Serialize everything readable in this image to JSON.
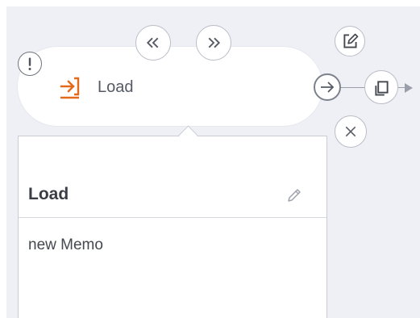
{
  "node": {
    "label": "Load",
    "status": "warning",
    "icon": "import-arrow-icon",
    "accent_color": "#e36a1a"
  },
  "toolbar": {
    "prev_icon": "double-chevron-left-icon",
    "next_icon": "double-chevron-right-icon",
    "edit_icon": "edit-icon",
    "connect_icon": "arrow-right-icon",
    "duplicate_icon": "copy-icon",
    "delete_icon": "close-icon"
  },
  "panel": {
    "title": "Load",
    "memo": "new Memo",
    "edit_icon": "pencil-icon"
  }
}
